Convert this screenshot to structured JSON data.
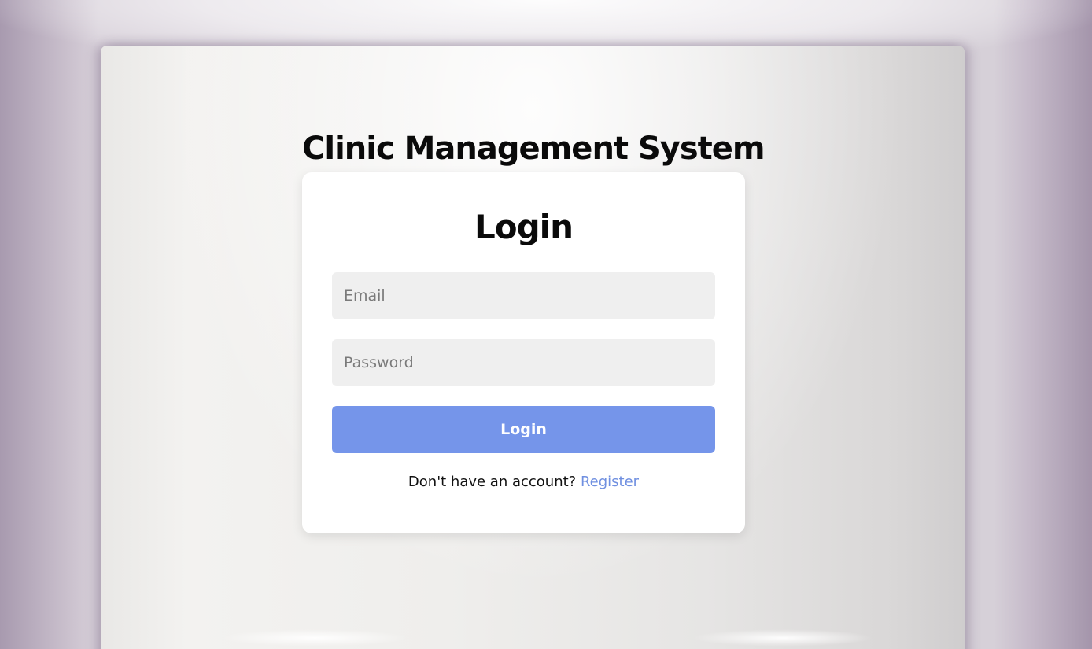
{
  "app": {
    "title": "Clinic Management System"
  },
  "login_card": {
    "heading": "Login",
    "email": {
      "placeholder": "Email",
      "value": ""
    },
    "password": {
      "placeholder": "Password",
      "value": ""
    },
    "submit_label": "Login",
    "register_prompt": "Don't have an account?",
    "register_link": "Register"
  },
  "colors": {
    "primary_button": "#7595ea",
    "link": "#6f8fe0",
    "input_background": "#efefef",
    "card_background": "#ffffff"
  }
}
